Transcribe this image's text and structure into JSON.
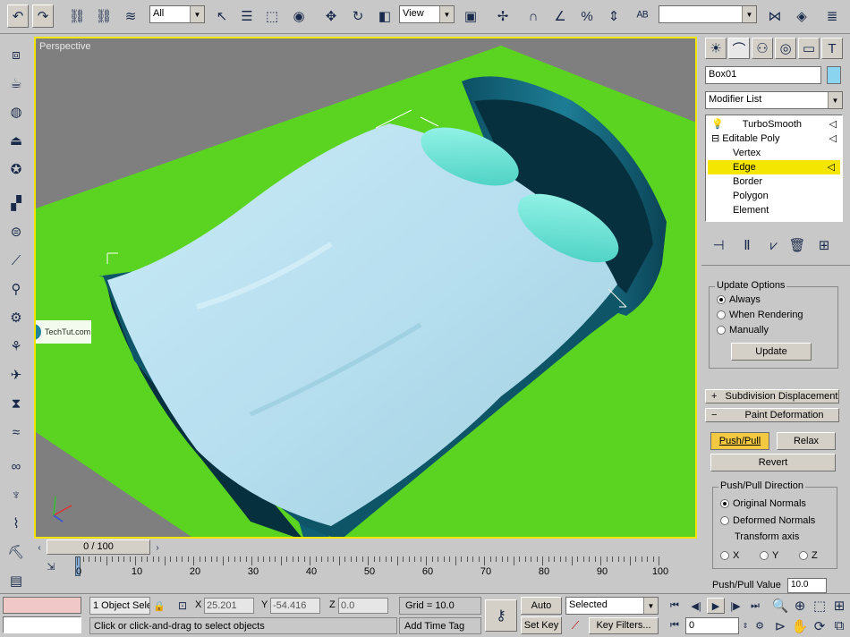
{
  "toolbar": {
    "selection_filter": "All",
    "ref_coord": "View",
    "named_selection": ""
  },
  "viewport": {
    "label": "Perspective",
    "watermark": "TechTut.com"
  },
  "panel": {
    "object_name": "Box01",
    "modifier_list": "Modifier List",
    "stack": [
      {
        "label": "TurboSmooth",
        "level": 0
      },
      {
        "label": "Editable Poly",
        "level": 0
      },
      {
        "label": "Vertex",
        "level": 1
      },
      {
        "label": "Edge",
        "level": 1,
        "selected": true
      },
      {
        "label": "Border",
        "level": 1
      },
      {
        "label": "Polygon",
        "level": 1
      },
      {
        "label": "Element",
        "level": 1
      }
    ],
    "update_options": {
      "title": "Update Options",
      "always": "Always",
      "when_rendering": "When Rendering",
      "manually": "Manually",
      "update_btn": "Update"
    },
    "rollout_subdiv": "Subdivision Displacement",
    "rollout_paint": "Paint Deformation",
    "push_pull": "Push/Pull",
    "relax": "Relax",
    "revert": "Revert",
    "direction": {
      "title": "Push/Pull Direction",
      "original": "Original Normals",
      "deformed": "Deformed Normals",
      "transform": "Transform axis",
      "x": "X",
      "y": "Y",
      "z": "Z"
    },
    "push_value_label": "Push/Pull Value",
    "push_value": "10.0"
  },
  "timeline": {
    "frame": "0 / 100",
    "ticks": [
      "0",
      "10",
      "20",
      "30",
      "40",
      "50",
      "60",
      "70",
      "80",
      "90",
      "100"
    ]
  },
  "status": {
    "selection": "1 Object Sele",
    "x_label": "X",
    "x_value": "25.201",
    "y_label": "Y",
    "y_value": "-54.416",
    "z_label": "Z",
    "z_value": "0.0",
    "grid": "Grid = 10.0",
    "prompt": "Click or click-and-drag to select objects",
    "add_time_tag": "Add Time Tag",
    "auto_key": "Auto Key",
    "set_key": "Set Key",
    "selected": "Selected",
    "key_filters": "Key Filters...",
    "frame_value": "0"
  }
}
